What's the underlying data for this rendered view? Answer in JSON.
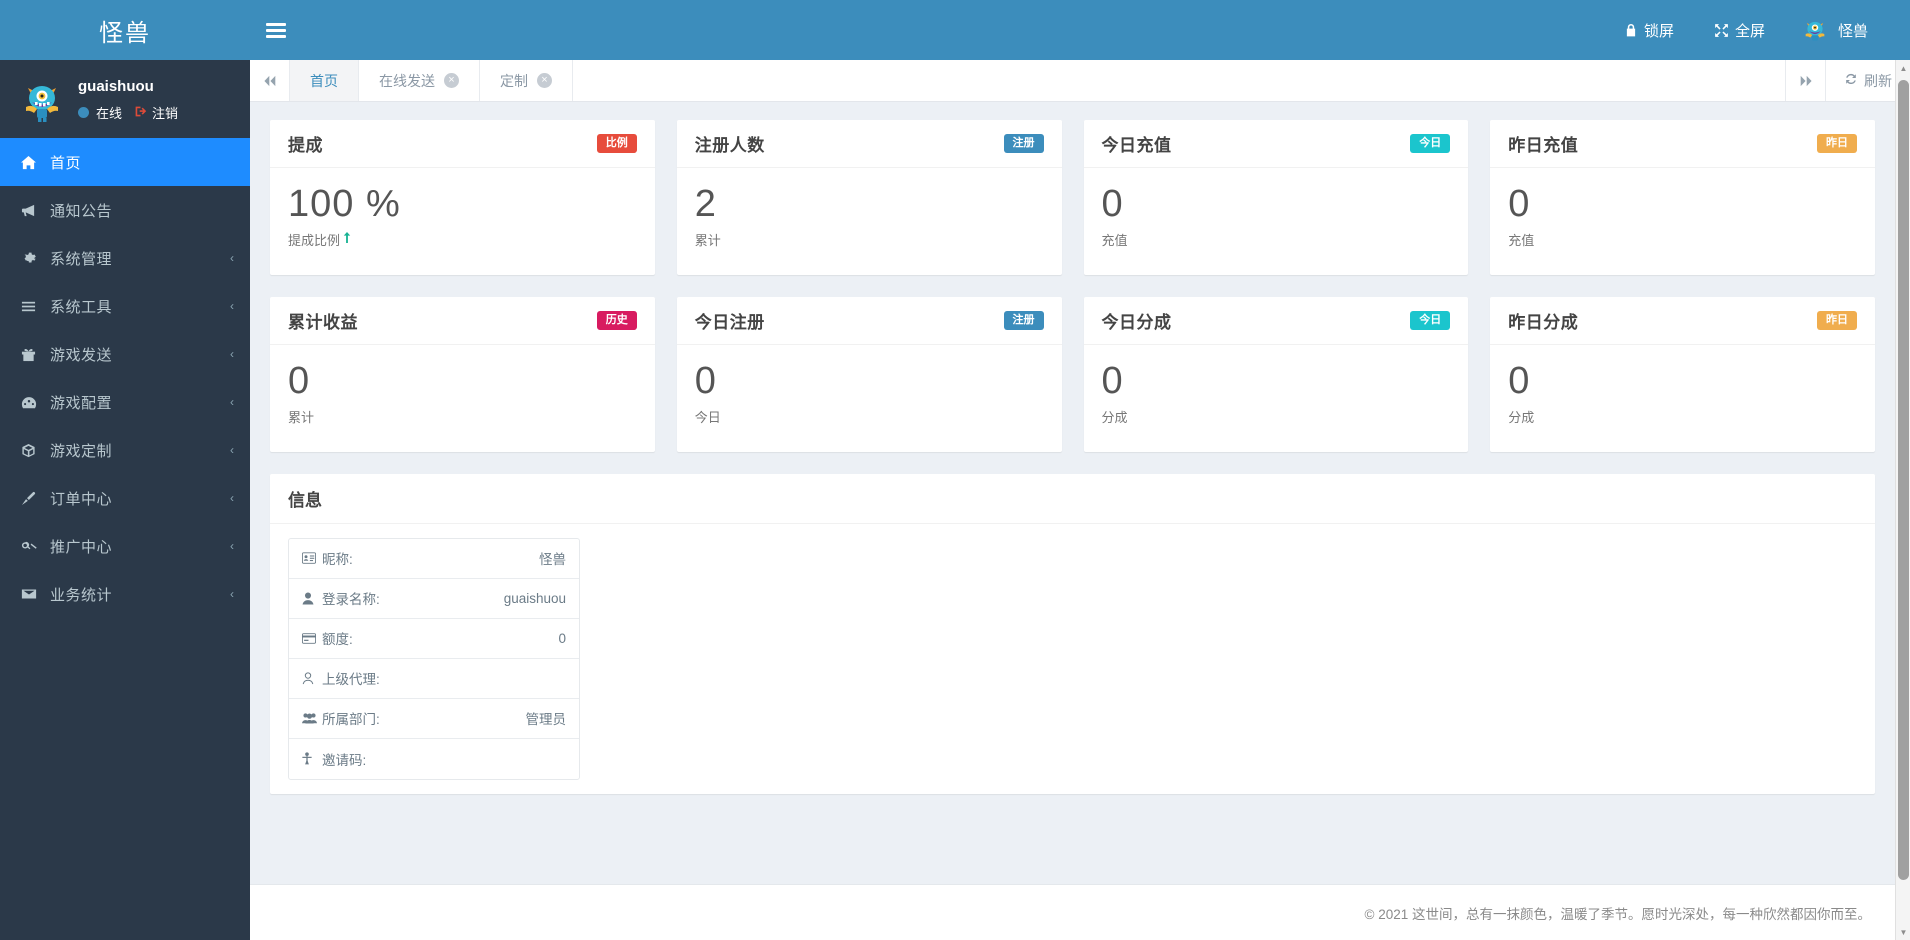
{
  "brand": {
    "title": "怪兽"
  },
  "user_panel": {
    "name": "guaishuou",
    "status_label": "在线",
    "logout_label": "注销",
    "avatar_icon": "monster-avatar-icon"
  },
  "sidebar": {
    "items": [
      {
        "label": "首页",
        "icon": "home-icon",
        "active": true,
        "has_arrow": false
      },
      {
        "label": "通知公告",
        "icon": "bullhorn-icon",
        "active": false,
        "has_arrow": false
      },
      {
        "label": "系统管理",
        "icon": "gear-icon",
        "active": false,
        "has_arrow": true
      },
      {
        "label": "系统工具",
        "icon": "list-icon",
        "active": false,
        "has_arrow": true
      },
      {
        "label": "游戏发送",
        "icon": "gift-icon",
        "active": false,
        "has_arrow": true
      },
      {
        "label": "游戏配置",
        "icon": "dashboard-icon",
        "active": false,
        "has_arrow": true
      },
      {
        "label": "游戏定制",
        "icon": "cube-icon",
        "active": false,
        "has_arrow": true
      },
      {
        "label": "订单中心",
        "icon": "brush-icon",
        "active": false,
        "has_arrow": true
      },
      {
        "label": "推广中心",
        "icon": "handshake-icon",
        "active": false,
        "has_arrow": true
      },
      {
        "label": "业务统计",
        "icon": "envelope-icon",
        "active": false,
        "has_arrow": true
      }
    ],
    "arrow_glyph": "‹"
  },
  "header": {
    "menu_toggle_icon": "hamburger-icon",
    "lock_label": "锁屏",
    "lock_icon": "lock-icon",
    "fullscreen_label": "全屏",
    "fullscreen_icon": "expand-icon",
    "user_label": "怪兽",
    "user_avatar_icon": "monster-avatar-icon"
  },
  "tabbar": {
    "prev_icon": "double-chevron-left-icon",
    "next_icon": "double-chevron-right-icon",
    "refresh_label": "刷新",
    "refresh_icon": "refresh-icon",
    "close_glyph": "×",
    "tabs": [
      {
        "label": "首页",
        "active": true,
        "closable": false
      },
      {
        "label": "在线发送",
        "active": false,
        "closable": true
      },
      {
        "label": "定制",
        "active": false,
        "closable": true
      }
    ]
  },
  "cards": [
    {
      "title": "提成",
      "badge": "比例",
      "badge_color": "#e74c3c",
      "value": "100 %",
      "sub": "提成比例",
      "trend_icon": "arrow-up-icon",
      "has_trend": true
    },
    {
      "title": "注册人数",
      "badge": "注册",
      "badge_color": "#3c8dbc",
      "value": "2",
      "sub": "累计",
      "trend_icon": "",
      "has_trend": false
    },
    {
      "title": "今日充值",
      "badge": "今日",
      "badge_color": "#1bc5cd",
      "value": "0",
      "sub": "充值",
      "trend_icon": "",
      "has_trend": false
    },
    {
      "title": "昨日充值",
      "badge": "昨日",
      "badge_color": "#f0ad4e",
      "value": "0",
      "sub": "充值",
      "trend_icon": "",
      "has_trend": false
    },
    {
      "title": "累计收益",
      "badge": "历史",
      "badge_color": "#d81b60",
      "value": "0",
      "sub": "累计",
      "trend_icon": "",
      "has_trend": false
    },
    {
      "title": "今日注册",
      "badge": "注册",
      "badge_color": "#3c8dbc",
      "value": "0",
      "sub": "今日",
      "trend_icon": "",
      "has_trend": false
    },
    {
      "title": "今日分成",
      "badge": "今日",
      "badge_color": "#1bc5cd",
      "value": "0",
      "sub": "分成",
      "trend_icon": "",
      "has_trend": false
    },
    {
      "title": "昨日分成",
      "badge": "昨日",
      "badge_color": "#f0ad4e",
      "value": "0",
      "sub": "分成",
      "trend_icon": "",
      "has_trend": false
    }
  ],
  "info": {
    "title": "信息",
    "rows": [
      {
        "label": "昵称:",
        "value": "怪兽",
        "icon": "id-card-icon"
      },
      {
        "label": "登录名称:",
        "value": "guaishuou",
        "icon": "user-icon"
      },
      {
        "label": "额度:",
        "value": "0",
        "icon": "credit-card-icon"
      },
      {
        "label": "上级代理:",
        "value": "",
        "icon": "user-outline-icon"
      },
      {
        "label": "所属部门:",
        "value": "管理员",
        "icon": "users-icon"
      },
      {
        "label": "邀请码:",
        "value": "",
        "icon": "person-tie-icon"
      }
    ]
  },
  "footer": {
    "text": "© 2021 这世间，总有一抹颜色，温暖了季节。愿时光深处，每一种欣然都因你而至。"
  },
  "scrollbar": {
    "up_glyph": "▲",
    "down_glyph": "▼"
  }
}
